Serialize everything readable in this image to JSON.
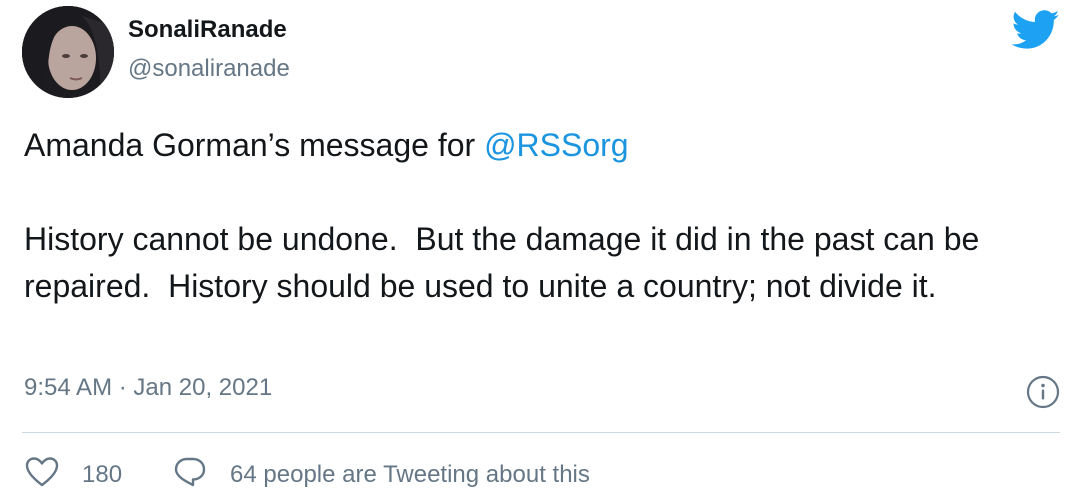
{
  "user": {
    "display_name": "SonaliRanade",
    "handle": "@sonaliranade"
  },
  "tweet": {
    "line1_prefix": "Amanda Gorman’s message for ",
    "mention": "@RSSorg",
    "paragraph2": "History cannot be undone.  But the damage it did in the past can be repaired.  History should be used to unite a country; not divide it."
  },
  "meta": {
    "time": "9:54 AM",
    "separator": " · ",
    "date": "Jan 20, 2021"
  },
  "actions": {
    "likes": "180",
    "reply_text": "64 people are Tweeting about this"
  },
  "colors": {
    "text": "#14171a",
    "secondary": "#657786",
    "link": "#1b95e0",
    "twitter_blue": "#1da1f2",
    "divider": "#ccd6dd"
  },
  "icons": {
    "brand": "twitter-bird-icon",
    "info": "info-icon",
    "like": "heart-icon",
    "reply": "speech-bubble-icon"
  }
}
